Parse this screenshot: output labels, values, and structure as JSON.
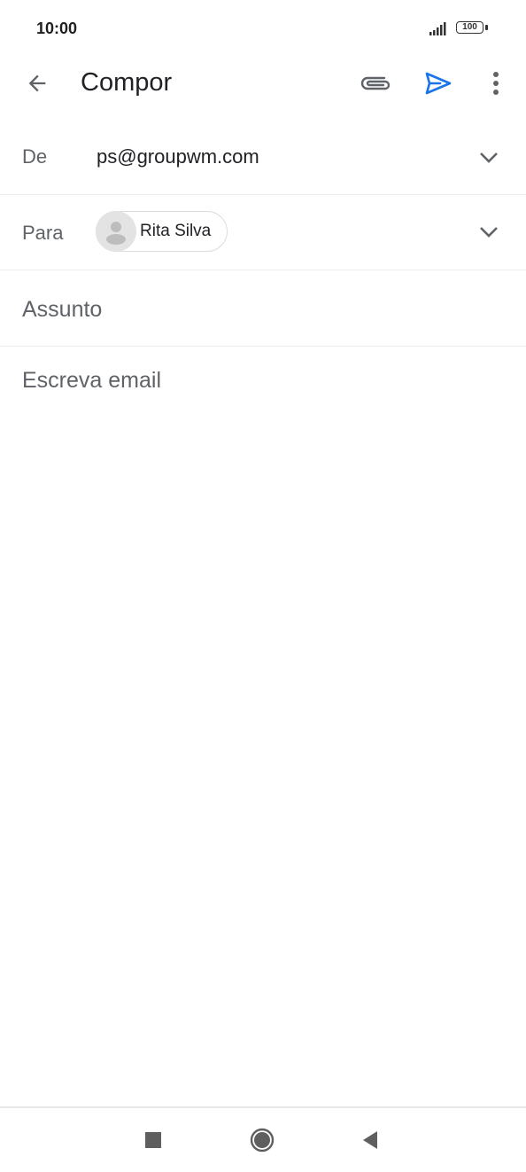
{
  "status_bar": {
    "time": "10:00",
    "battery": "100"
  },
  "toolbar": {
    "title": "Compor",
    "back_icon": "arrow-back-icon",
    "attach_icon": "paperclip-icon",
    "send_icon": "send-icon",
    "more_icon": "more-vertical-icon",
    "send_color": "#1a73e8"
  },
  "compose": {
    "from_label": "De",
    "from_value": "ps@groupwm.com",
    "to_label": "Para",
    "to_chip": "Rita Silva",
    "subject_placeholder": "Assunto",
    "body_placeholder": "Escreva email"
  },
  "nav": {
    "recents_icon": "square-icon",
    "home_icon": "circle-icon",
    "back_icon": "triangle-back-icon"
  }
}
